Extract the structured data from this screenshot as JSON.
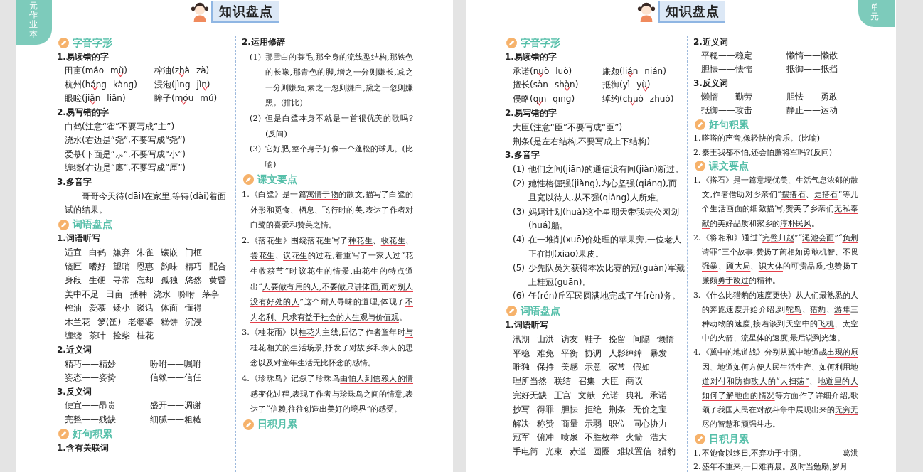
{
  "pages": [
    {
      "side_tab": "元作业本",
      "title": "知识盘点",
      "columns": [
        [
          {
            "kind": "section",
            "text": "字音字形"
          },
          {
            "kind": "subheading",
            "text": "1.易读错的字"
          },
          {
            "kind": "pinyin",
            "items": [
              {
                "word": "田亩",
                "options": [
                  {
                    "text": "(mǎo",
                    "checked": false
                  },
                  {
                    "text": "mǔ)",
                    "checked": true
                  }
                ]
              },
              {
                "word": "榨油",
                "options": [
                  {
                    "text": "(zhà",
                    "checked": true
                  },
                  {
                    "text": "zà)",
                    "checked": false
                  }
                ]
              },
              {
                "word": "杭州",
                "options": [
                  {
                    "text": "(háng",
                    "checked": true
                  },
                  {
                    "text": "kàng)",
                    "checked": false
                  }
                ]
              },
              {
                "word": "浸泡",
                "options": [
                  {
                    "text": "(jìng",
                    "checked": false
                  },
                  {
                    "text": "jìn)",
                    "checked": true
                  }
                ]
              },
              {
                "word": "眼睑",
                "options": [
                  {
                    "text": "(jiǎn",
                    "checked": true
                  },
                  {
                    "text": "liǎn)",
                    "checked": false
                  }
                ]
              },
              {
                "word": "眸子",
                "options": [
                  {
                    "text": "(móu",
                    "checked": true
                  },
                  {
                    "text": "mú)",
                    "checked": false
                  }
                ]
              }
            ]
          },
          {
            "kind": "subheading",
            "text": "2.易写错的字"
          },
          {
            "kind": "lines",
            "items": [
              "白鹤(注意“隺”不要写成“主”)",
              "浇水(右边是“尧”,不要写成“尧”)",
              "爱慕(下面是“⺗”,不要写成“小”)",
              "缠绕(右边是“廛”,不要写成“厘”)"
            ]
          },
          {
            "kind": "subheading",
            "text": "3.多音字"
          },
          {
            "kind": "para",
            "text": "哥哥今天待(dāi)在家里,等待(dài)着面试的结果。"
          },
          {
            "kind": "section",
            "text": "词语盘点"
          },
          {
            "kind": "subheading",
            "text": "1.词语听写"
          },
          {
            "kind": "words",
            "rows": [
              "适宜 白鹤 嫌弃 朱雀 镶嵌 门框",
              "镜匣 嗜好 望哨 恩惠 韵味 精巧 配合",
              "身段 生硬 寻常 忘却 孤独 悠然 黄昏",
              "美中不足 田亩 播种 浇水 吩咐 茅亭",
              "榨油 爱慕 矮小 谈话 体面 懂得",
              "木兰花 箩(筐) 老婆婆 糕饼 沉浸",
              "缠绕 茶叶 捡柴 桂花"
            ]
          },
          {
            "kind": "subheading",
            "text": "2.近义词"
          },
          {
            "kind": "pairs",
            "items": [
              "精巧——精妙",
              "吩咐——嘱咐",
              "姿态——姿势",
              "信赖——信任"
            ]
          },
          {
            "kind": "subheading",
            "text": "3.反义词"
          },
          {
            "kind": "pairs",
            "items": [
              "便宜——昂贵",
              "盛开——凋谢",
              "完整——残缺",
              "细腻——粗糙"
            ]
          },
          {
            "kind": "section",
            "text": "好句积累"
          },
          {
            "kind": "subheading",
            "text": "1.含有关联词"
          }
        ],
        [
          {
            "kind": "subheading",
            "text": "2.运用修辞"
          },
          {
            "kind": "numbered",
            "items": [
              {
                "label": "(1)",
                "text": "那雪白的蓑毛,那全身的流线型结构,那铁色的长喙,那青色的脚,增之一分则嫌长,减之一分则嫌短,素之一忽则嫌白,黛之一忽则嫌黑。(排比)"
              },
              {
                "label": "(2)",
                "text": "但是白鹭本身不就是一首很优美的歌吗?(反问)"
              },
              {
                "label": "(3)",
                "text": "它好肥,整个身子好像一个蓬松的球儿。(比喻)"
              }
            ]
          },
          {
            "kind": "section",
            "text": "课文要点"
          },
          {
            "kind": "points",
            "items": [
              {
                "label": "1.",
                "segments": [
                  {
                    "text": "《白鹭》是一篇",
                    "underlined": false
                  },
                  {
                    "text": "寓情于物",
                    "underlined": true
                  },
                  {
                    "text": "的散文,描写了白鹭的",
                    "underlined": false
                  },
                  {
                    "text": "外形",
                    "underlined": true
                  },
                  {
                    "text": "和",
                    "underlined": false
                  },
                  {
                    "text": "觅食",
                    "underlined": true
                  },
                  {
                    "text": "、",
                    "underlined": false
                  },
                  {
                    "text": "栖息",
                    "underlined": true
                  },
                  {
                    "text": "、",
                    "underlined": false
                  },
                  {
                    "text": "飞行",
                    "underlined": true
                  },
                  {
                    "text": "时的美,表达了作者对白鹭的",
                    "underlined": false
                  },
                  {
                    "text": "喜爱和赞美",
                    "underlined": true
                  },
                  {
                    "text": "之情。",
                    "underlined": false
                  }
                ]
              },
              {
                "label": "2.",
                "segments": [
                  {
                    "text": "《落花生》围绕落花生写了",
                    "underlined": false
                  },
                  {
                    "text": "种花生",
                    "underlined": true
                  },
                  {
                    "text": "、",
                    "underlined": false
                  },
                  {
                    "text": "收花生",
                    "underlined": true
                  },
                  {
                    "text": "、",
                    "underlined": false
                  },
                  {
                    "text": "尝花生",
                    "underlined": true
                  },
                  {
                    "text": "、",
                    "underlined": false
                  },
                  {
                    "text": "议花生",
                    "underlined": true
                  },
                  {
                    "text": "的过程,着重写了一家人过“花生收获节”时议花生的情景,由花生的特点道出“",
                    "underlined": false
                  },
                  {
                    "text": "人要做有用的人,不要做只讲体面,而对别人没有好处的人",
                    "underlined": true
                  },
                  {
                    "text": "”这个耐人寻味的道理,体现了",
                    "underlined": false
                  },
                  {
                    "text": "不为名利、只求有益于社会的人生观与价值观",
                    "underlined": true
                  },
                  {
                    "text": "。",
                    "underlined": false
                  }
                ]
              },
              {
                "label": "3.",
                "segments": [
                  {
                    "text": "《桂花雨》以",
                    "underlined": false
                  },
                  {
                    "text": "桂花",
                    "underlined": true
                  },
                  {
                    "text": "为主线,回忆了作者童年时",
                    "underlined": false
                  },
                  {
                    "text": "与桂花相关的生活场景",
                    "underlined": true
                  },
                  {
                    "text": ",抒发了",
                    "underlined": false
                  },
                  {
                    "text": "对故乡和亲人的思念",
                    "underlined": true
                  },
                  {
                    "text": "以及",
                    "underlined": false
                  },
                  {
                    "text": "对童年生活无比怀念",
                    "underlined": true
                  },
                  {
                    "text": "的感情。",
                    "underlined": false
                  }
                ]
              },
              {
                "label": "4.",
                "segments": [
                  {
                    "text": "《珍珠鸟》记叙了珍珠鸟",
                    "underlined": false
                  },
                  {
                    "text": "由怕人到信赖人的情感变化",
                    "underlined": true
                  },
                  {
                    "text": "过程,表现了作者与珍珠鸟之间的情意,表达了“",
                    "underlined": false
                  },
                  {
                    "text": "信赖,往往创造出美好的境界",
                    "underlined": true
                  },
                  {
                    "text": "”的感受。",
                    "underlined": false
                  }
                ]
              }
            ]
          },
          {
            "kind": "section",
            "text": "日积月累"
          }
        ]
      ]
    },
    {
      "side_tab": "单元",
      "title": "知识盘点",
      "columns": [
        [
          {
            "kind": "section",
            "text": "字音字形"
          },
          {
            "kind": "subheading",
            "text": "1.易读错的字"
          },
          {
            "kind": "pinyin",
            "items": [
              {
                "word": "承诺",
                "options": [
                  {
                    "text": "(nuò",
                    "checked": true
                  },
                  {
                    "text": "luò)",
                    "checked": false
                  }
                ]
              },
              {
                "word": "廉颇",
                "options": [
                  {
                    "text": "(lián",
                    "checked": true
                  },
                  {
                    "text": "nián)",
                    "checked": false
                  }
                ]
              },
              {
                "word": "擅长",
                "options": [
                  {
                    "text": "(sàn",
                    "checked": false
                  },
                  {
                    "text": "shàn)",
                    "checked": true
                  }
                ]
              },
              {
                "word": "抵御",
                "options": [
                  {
                    "text": "(yì",
                    "checked": false
                  },
                  {
                    "text": "yù)",
                    "checked": true
                  }
                ]
              },
              {
                "word": "侵略",
                "options": [
                  {
                    "text": "(qīn",
                    "checked": true
                  },
                  {
                    "text": "qīng)",
                    "checked": false
                  }
                ]
              },
              {
                "word": "绰约",
                "options": [
                  {
                    "text": "(chuò",
                    "checked": true
                  },
                  {
                    "text": "zhuó)",
                    "checked": false
                  }
                ]
              }
            ]
          },
          {
            "kind": "subheading",
            "text": "2.易写错的字"
          },
          {
            "kind": "lines",
            "items": [
              "大臣(注意“臣”不要写成“臣”)",
              "荆条(是左右结构,不要写成上下结构)"
            ]
          },
          {
            "kind": "subheading",
            "text": "3.多音字"
          },
          {
            "kind": "numbered",
            "items": [
              {
                "label": "(1)",
                "text": "他们之间(jiān)的通信没有间(jiàn)断过。"
              },
              {
                "label": "(2)",
                "text": "她性格倔强(jiàng),内心坚强(qiáng),而且宽以待人,从不强(qiǎng)人所难。"
              },
              {
                "label": "(3)",
                "text": "妈妈计划(huà)这个星期天带我去公园划(huá)船。"
              },
              {
                "label": "(4)",
                "text": "在一堆削(xuē)价处理的苹果旁,一位老人正在削(xiāo)果皮。"
              },
              {
                "label": "(5)",
                "text": "少先队员为获得本次比赛的冠(guàn)军戴上桂冠(guān)。"
              },
              {
                "label": "(6)",
                "text": "任(rén)丘军民圆满地完成了任(rèn)务。"
              }
            ]
          },
          {
            "kind": "section",
            "text": "词语盘点"
          },
          {
            "kind": "subheading",
            "text": "1.词语听写"
          },
          {
            "kind": "words",
            "rows": [
              "汛期 山洪 访友 鞋子 挽留 间隔 懒惰",
              "平稳 难免 平衡 协调 人影绰绰 暴发",
              "唯独 保持 美感 示意 家常 假如",
              "理所当然 联结 召集 大臣 商议",
              "完好无缺 王宫 文献 允诺 典礼 承诺",
              "抄写 得罪 胆怯 拒绝 荆条 无价之宝",
              "解决 称赞 商量 示弱 职位 同心协力",
              "冠军 俯冲 喷泉 不胜枚举 火箭 浩大",
              "手电筒 光束 赤道 圆圈 难以置信 猎豹"
            ]
          }
        ],
        [
          {
            "kind": "subheading",
            "text": "2.近义词"
          },
          {
            "kind": "pairs",
            "items": [
              "平稳——稳定",
              "懒惰——懒散",
              "胆怯——怯懦",
              "抵御——抵挡"
            ]
          },
          {
            "kind": "subheading",
            "text": "3.反义词"
          },
          {
            "kind": "pairs",
            "items": [
              "懒惰——勤劳",
              "胆怯——勇敢",
              "抵御——攻击",
              "静止——运动"
            ]
          },
          {
            "kind": "section",
            "text": "好句积累"
          },
          {
            "kind": "numbered",
            "items": [
              {
                "label": "1.",
                "text": "嗒嗒的声音,像轻快的音乐。(比喻)"
              },
              {
                "label": "2.",
                "text": "秦王我都不怕,还会怕廉将军吗?(反问)"
              }
            ]
          },
          {
            "kind": "section",
            "text": "课文要点"
          },
          {
            "kind": "points",
            "items": [
              {
                "label": "1.",
                "segments": [
                  {
                    "text": "《搭石》是一篇意境优美、生活气息浓郁的散文,作者借助对乡亲们“",
                    "underlined": false
                  },
                  {
                    "text": "摆搭石",
                    "underlined": true
                  },
                  {
                    "text": "、",
                    "underlined": false
                  },
                  {
                    "text": "走搭石",
                    "underlined": true
                  },
                  {
                    "text": "”等几个生活画面的细致描写,赞美了乡亲们",
                    "underlined": false
                  },
                  {
                    "text": "无私奉献",
                    "underlined": true
                  },
                  {
                    "text": "的美好品质和家乡的",
                    "underlined": false
                  },
                  {
                    "text": "淳朴民风",
                    "underlined": true
                  },
                  {
                    "text": "。",
                    "underlined": false
                  }
                ]
              },
              {
                "label": "2.",
                "segments": [
                  {
                    "text": "《将相和》通过“",
                    "underlined": false
                  },
                  {
                    "text": "完璧归赵",
                    "underlined": true
                  },
                  {
                    "text": "”“",
                    "underlined": false
                  },
                  {
                    "text": "渑池会面",
                    "underlined": true
                  },
                  {
                    "text": "”“",
                    "underlined": false
                  },
                  {
                    "text": "负荆请罪",
                    "underlined": true
                  },
                  {
                    "text": "”三个故事,赞扬了蔺相如",
                    "underlined": false
                  },
                  {
                    "text": "勇敢机智",
                    "underlined": true
                  },
                  {
                    "text": "、",
                    "underlined": false
                  },
                  {
                    "text": "不畏强暴",
                    "underlined": true
                  },
                  {
                    "text": "、",
                    "underlined": false
                  },
                  {
                    "text": "顾大局",
                    "underlined": true
                  },
                  {
                    "text": "、",
                    "underlined": false
                  },
                  {
                    "text": "识大体",
                    "underlined": true
                  },
                  {
                    "text": "的可贵品质,也赞扬了廉颇",
                    "underlined": false
                  },
                  {
                    "text": "勇于改过",
                    "underlined": true
                  },
                  {
                    "text": "的精神。",
                    "underlined": false
                  }
                ]
              },
              {
                "label": "3.",
                "segments": [
                  {
                    "text": "《什么比猎豹的速度更快》从人们最熟悉的人的奔跑速度开始介绍,到",
                    "underlined": false
                  },
                  {
                    "text": "鸵鸟",
                    "underlined": true
                  },
                  {
                    "text": "、",
                    "underlined": false
                  },
                  {
                    "text": "猎豹",
                    "underlined": true
                  },
                  {
                    "text": "、",
                    "underlined": false
                  },
                  {
                    "text": "游隼",
                    "underlined": true
                  },
                  {
                    "text": "三种动物的速度,接着谈到天空中的",
                    "underlined": false
                  },
                  {
                    "text": "飞机",
                    "underlined": true
                  },
                  {
                    "text": "、太空中的",
                    "underlined": false
                  },
                  {
                    "text": "火箭",
                    "underlined": true
                  },
                  {
                    "text": "、",
                    "underlined": false
                  },
                  {
                    "text": "流星体",
                    "underlined": true
                  },
                  {
                    "text": "的速度,最后说到",
                    "underlined": false
                  },
                  {
                    "text": "光速",
                    "underlined": true
                  },
                  {
                    "text": "。",
                    "underlined": false
                  }
                ]
              },
              {
                "label": "4.",
                "segments": [
                  {
                    "text": "《冀中的地道战》分别从冀中地道战",
                    "underlined": false
                  },
                  {
                    "text": "出现的原因",
                    "underlined": true
                  },
                  {
                    "text": "、",
                    "underlined": false
                  },
                  {
                    "text": "地道如何方便人民生活生产",
                    "underlined": true
                  },
                  {
                    "text": "、",
                    "underlined": false
                  },
                  {
                    "text": "如何利用地道对付和防御敌人的“大扫荡”",
                    "underlined": true
                  },
                  {
                    "text": "、",
                    "underlined": false
                  },
                  {
                    "text": "地道里的人如何了解地面的情况",
                    "underlined": true
                  },
                  {
                    "text": "等方面作了详细介绍,歌颂了我国人民在对敌斗争中展现出来的",
                    "underlined": false
                  },
                  {
                    "text": "无穷无尽的智慧",
                    "underlined": true
                  },
                  {
                    "text": "和",
                    "underlined": false
                  },
                  {
                    "text": "顽强斗志",
                    "underlined": true
                  },
                  {
                    "text": "。",
                    "underlined": false
                  }
                ]
              }
            ]
          },
          {
            "kind": "section",
            "text": "日积月累"
          },
          {
            "kind": "numbered",
            "items": [
              {
                "label": "1.",
                "text": "不饱食以终日,不弃功于寸阴。",
                "source": "——葛洪"
              },
              {
                "label": "2.",
                "text": "盛年不重来,一日难再晨。及时当勉励,岁月"
              }
            ]
          }
        ]
      ]
    }
  ]
}
